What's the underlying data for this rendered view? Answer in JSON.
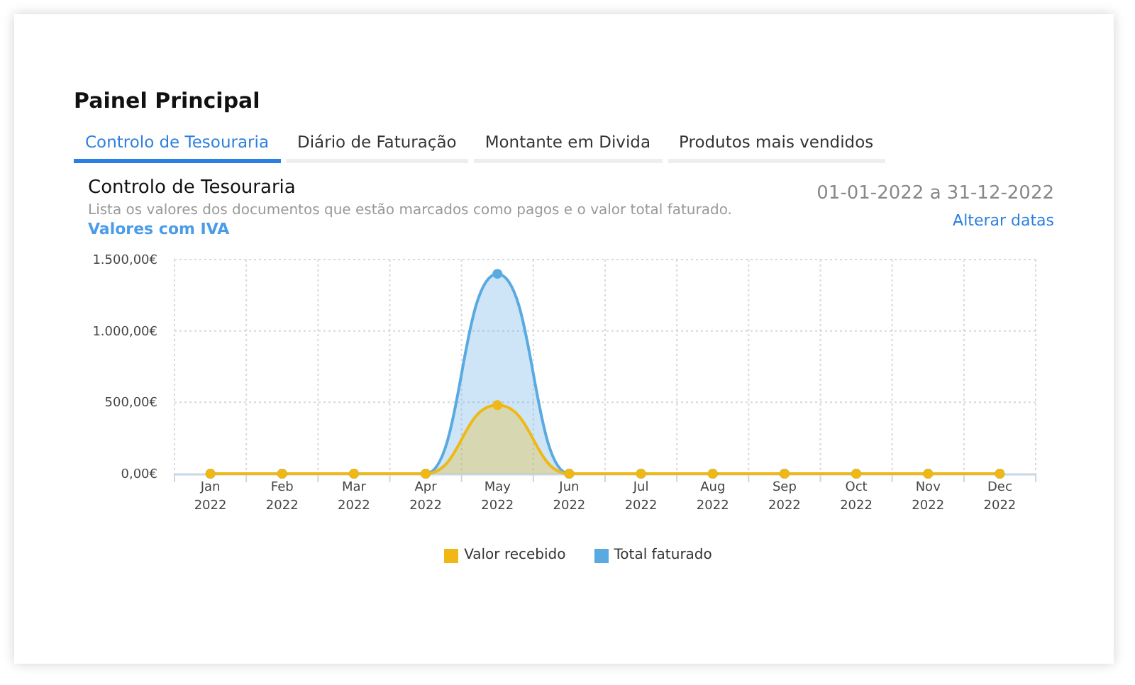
{
  "page_title": "Painel Principal",
  "tabs": [
    {
      "label": "Controlo de Tesouraria",
      "selected": true
    },
    {
      "label": "Diário de Faturação",
      "selected": false
    },
    {
      "label": "Montante em Divida",
      "selected": false
    },
    {
      "label": "Produtos mais vendidos",
      "selected": false
    }
  ],
  "section": {
    "title": "Controlo de Tesouraria",
    "description": "Lista os valores dos documentos que estão marcados como pagos e o valor total faturado.",
    "vat_note": "Valores com IVA",
    "date_range": "01-01-2022 a 31-12-2022",
    "change_dates_link": "Alterar datas"
  },
  "chart_data": {
    "type": "area",
    "categories": [
      "Jan 2022",
      "Feb 2022",
      "Mar 2022",
      "Apr 2022",
      "May 2022",
      "Jun 2022",
      "Jul 2022",
      "Aug 2022",
      "Sep 2022",
      "Oct 2022",
      "Nov 2022",
      "Dec 2022"
    ],
    "ylim": [
      0,
      1500
    ],
    "yticks": [
      {
        "value": 0,
        "label": "0,00€"
      },
      {
        "value": 500,
        "label": "500,00€"
      },
      {
        "value": 1000,
        "label": "1.000,00€"
      },
      {
        "value": 1500,
        "label": "1.500,00€"
      }
    ],
    "series": [
      {
        "name": "Total faturado",
        "color": "#5aaae2",
        "values": [
          0,
          0,
          0,
          0,
          1400,
          0,
          0,
          0,
          0,
          0,
          0,
          0
        ]
      },
      {
        "name": "Valor recebido",
        "color": "#f0b814",
        "values": [
          0,
          0,
          0,
          0,
          480,
          0,
          0,
          0,
          0,
          0,
          0,
          0
        ]
      }
    ]
  }
}
